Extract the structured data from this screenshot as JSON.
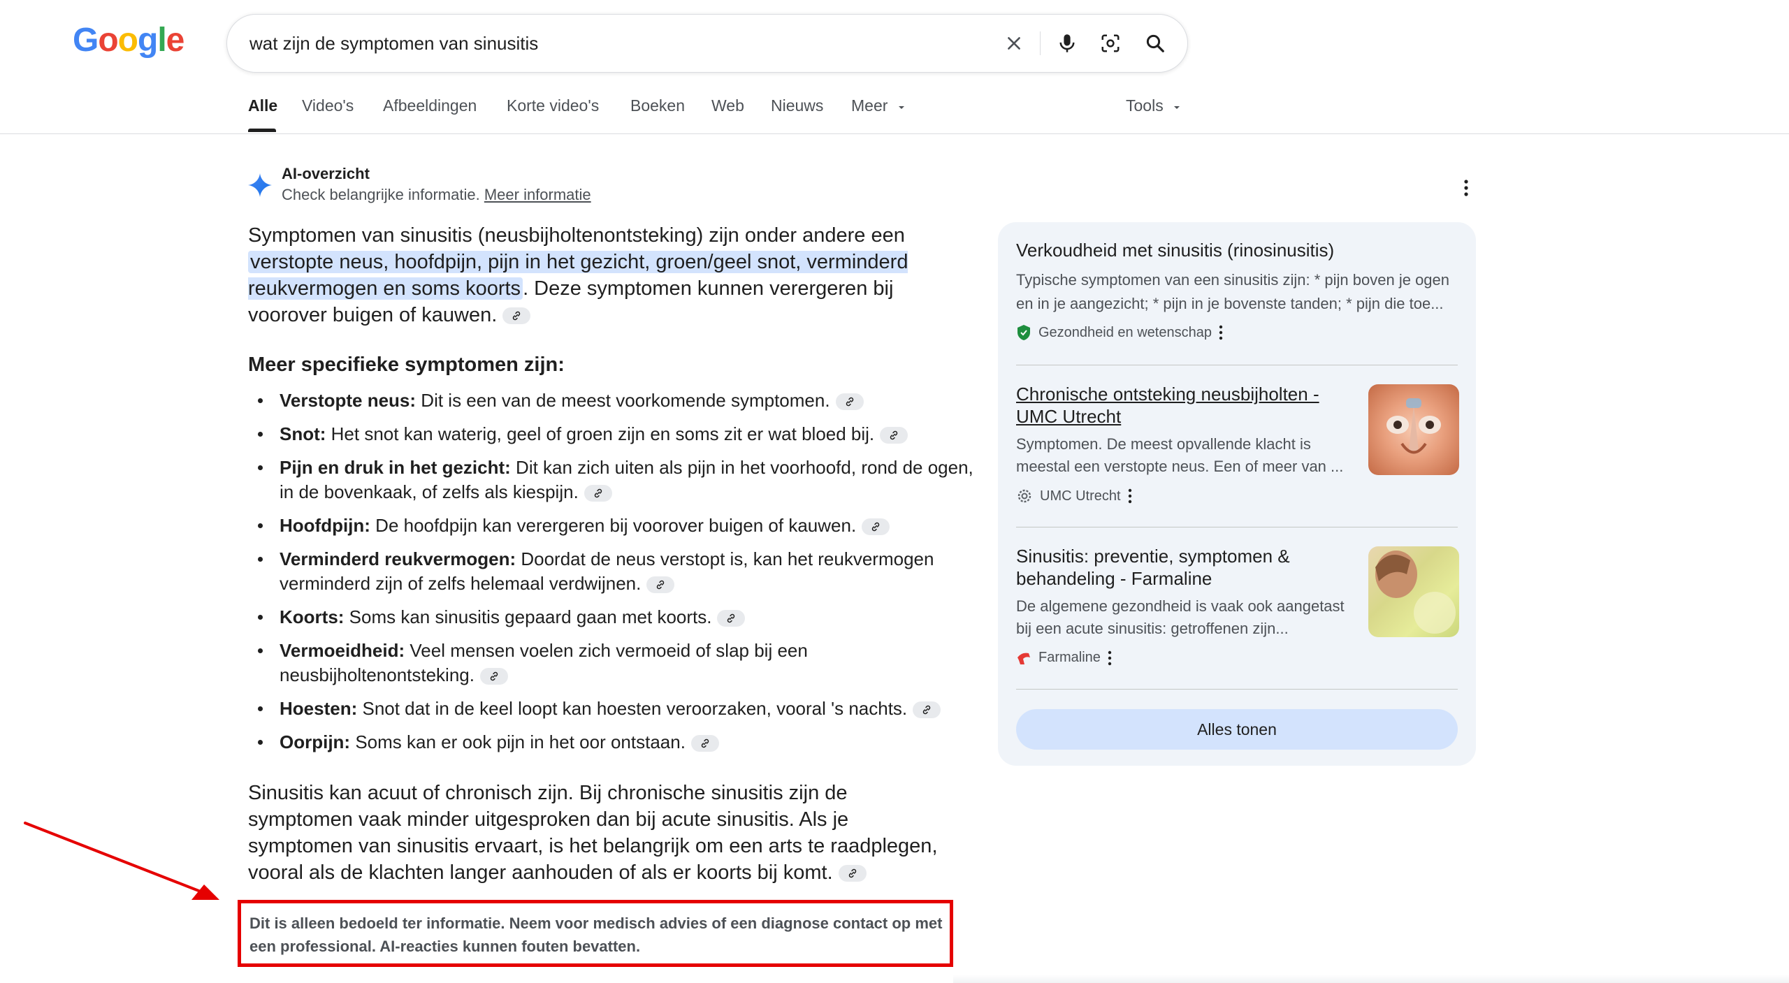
{
  "search": {
    "query": "wat zijn de symptomen van sinusitis"
  },
  "logo": [
    "G",
    "o",
    "o",
    "g",
    "l",
    "e"
  ],
  "tabs": [
    "Alle",
    "Video's",
    "Afbeeldingen",
    "Korte video's",
    "Boeken",
    "Web",
    "Nieuws",
    "Meer"
  ],
  "tools_label": "Tools",
  "ai_overview": {
    "title": "AI-overzicht",
    "subtitle": "Check belangrijke informatie.",
    "more_link": "Meer informatie",
    "intro_before": "Symptomen van sinusitis (neusbijholtenontsteking) zijn onder andere een ",
    "intro_highlight": "verstopte neus, hoofdpijn, pijn in het gezicht, groen/geel snot, verminderd reukvermogen en soms koorts",
    "intro_after": ". Deze symptomen kunnen verergeren bij voorover buigen of kauwen.",
    "subheading": "Meer specifieke symptomen zijn:",
    "symptoms": [
      {
        "term": "Verstopte neus:",
        "text": " Dit is een van de meest voorkomende symptomen."
      },
      {
        "term": "Snot:",
        "text": " Het snot kan waterig, geel of groen zijn en soms zit er wat bloed bij."
      },
      {
        "term": "Pijn en druk in het gezicht:",
        "text": " Dit kan zich uiten als pijn in het voorhoofd, rond de ogen, in de bovenkaak, of zelfs als kiespijn."
      },
      {
        "term": "Hoofdpijn:",
        "text": " De hoofdpijn kan verergeren bij voorover buigen of kauwen."
      },
      {
        "term": "Verminderd reukvermogen:",
        "text": " Doordat de neus verstopt is, kan het reukvermogen verminderd zijn of zelfs helemaal verdwijnen."
      },
      {
        "term": "Koorts:",
        "text": " Soms kan sinusitis gepaard gaan met koorts."
      },
      {
        "term": "Vermoeidheid:",
        "text": " Veel mensen voelen zich vermoeid of slap bij een neusbijholtenontsteking."
      },
      {
        "term": "Hoesten:",
        "text": " Snot dat in de keel loopt kan hoesten veroorzaken, vooral 's nachts."
      },
      {
        "term": "Oorpijn:",
        "text": " Soms kan er ook pijn in het oor ontstaan."
      }
    ],
    "closing": "Sinusitis kan acuut of chronisch zijn. Bij chronische sinusitis zijn de symptomen vaak minder uitgesproken dan bij acute sinusitis. Als je symptomen van sinusitis ervaart, is het belangrijk om een arts te raadplegen, vooral als de klachten langer aanhouden of als er koorts bij komt.",
    "disclaimer": "Dit is alleen bedoeld ter informatie. Neem voor medisch advies of een diagnose contact op met een professional. AI-reacties kunnen fouten bevatten."
  },
  "sources": [
    {
      "title": "Verkoudheid met sinusitis (rinosinusitis)",
      "snippet": "Typische symptomen van een sinusitis zijn: * pijn boven je ogen en in je aangezicht; * pijn in je bovenste tanden; * pijn die toe...",
      "site": "Gezondheid en wetenschap",
      "icon": "shield-icon",
      "color": "#1e8e3e"
    },
    {
      "title": "Chronische ontsteking neusbijholten - UMC Utrecht",
      "snippet": "Symptomen. De meest opvallende klacht is meestal een verstopte neus. Een of meer van ...",
      "site": "UMC Utrecht",
      "icon": "gear-icon",
      "color": "#5f6368"
    },
    {
      "title": "Sinusitis: preventie, symptomen & behandeling - Farmaline",
      "snippet": "De algemene gezondheid is vaak ook aangetast bij een acute sinusitis: getroffenen zijn...",
      "site": "Farmaline",
      "icon": "farmaline-logo-icon",
      "color": "#e53935"
    }
  ],
  "show_all_label": "Alles tonen",
  "colors": {
    "accent_blue": "#4285f4",
    "highlight": "#d3e3fd",
    "panel_bg": "#f0f4f9",
    "annotation_red": "#e50000"
  }
}
